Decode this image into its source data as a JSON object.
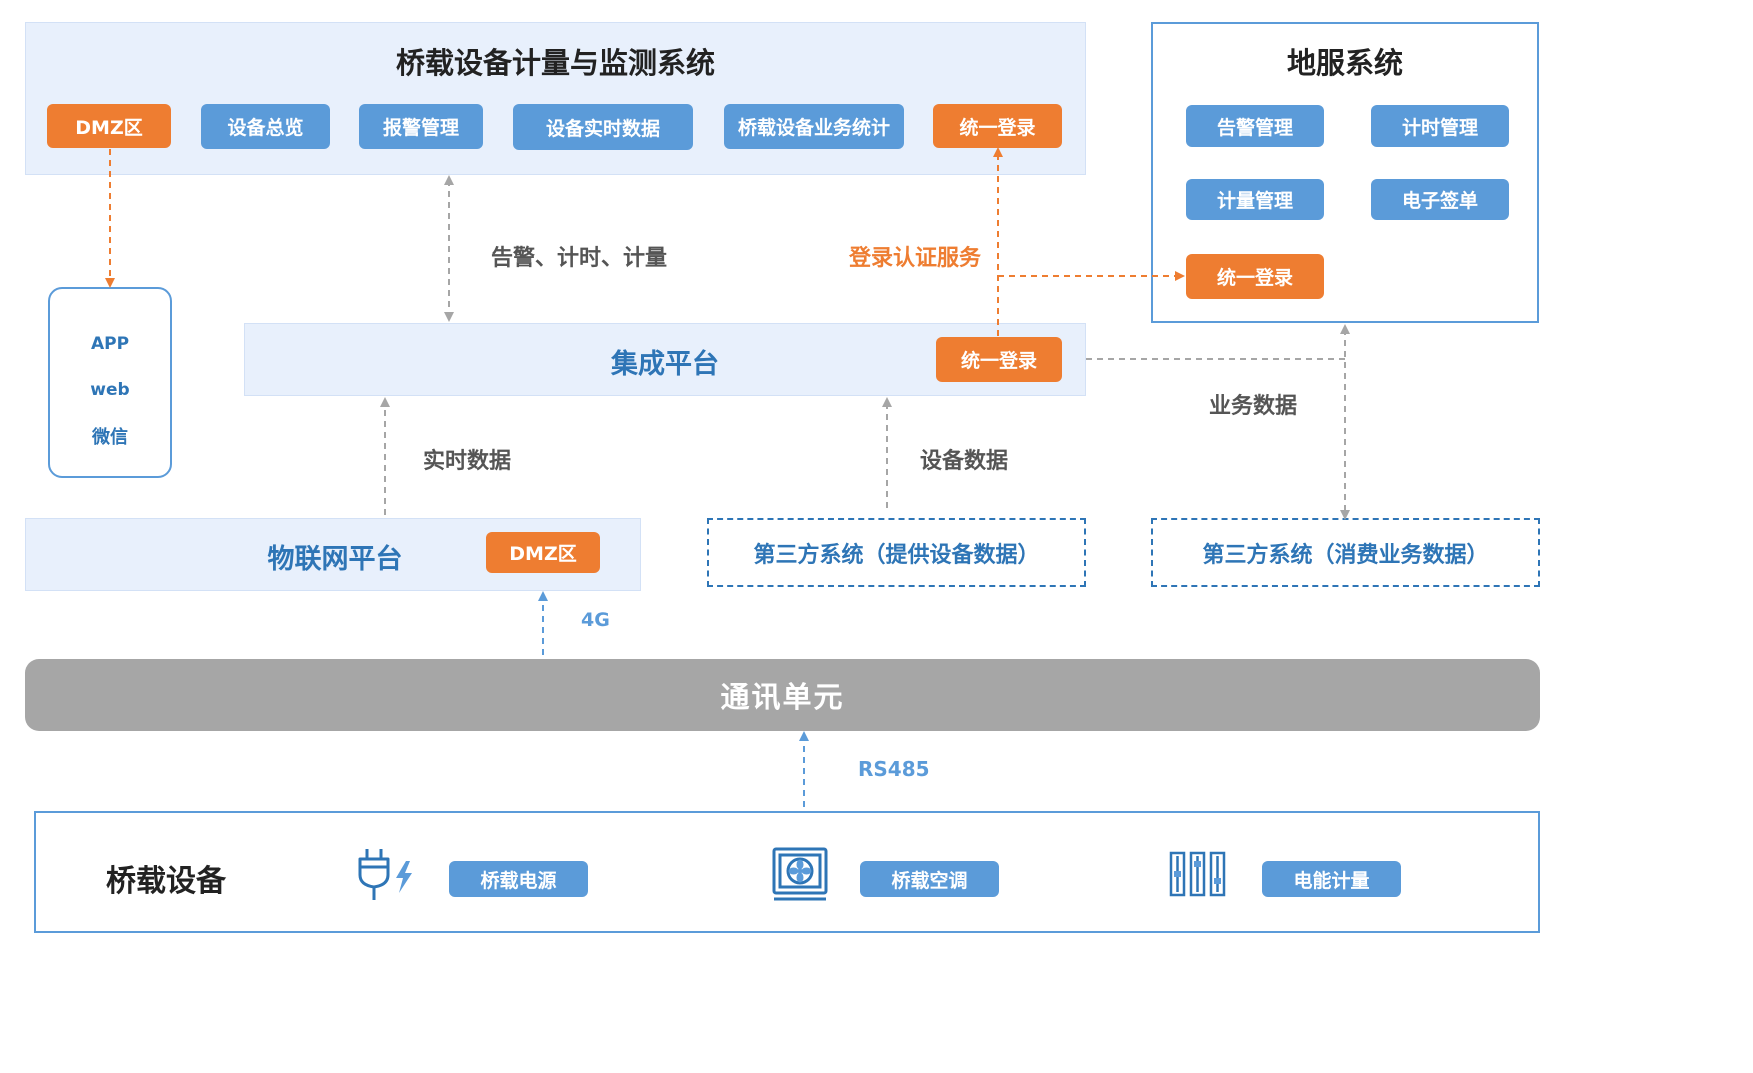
{
  "top_system": {
    "title": "桥载设备计量与监测系统",
    "modules": [
      "DMZ区",
      "设备总览",
      "报警管理",
      "设备实时数据",
      "桥载设备业务统计",
      "统一登录"
    ]
  },
  "ground_system": {
    "title": "地服系统",
    "modules": [
      "告警管理",
      "计时管理",
      "计量管理",
      "电子签单",
      "统一登录"
    ]
  },
  "clients": [
    "APP",
    "web",
    "微信"
  ],
  "integration_platform": {
    "title": "集成平台",
    "login": "统一登录"
  },
  "iot_platform": {
    "title": "物联网平台",
    "dmz": "DMZ区"
  },
  "third_party_device": "第三方系统（提供设备数据）",
  "third_party_business": "第三方系统（消费业务数据）",
  "comm_unit": "通讯单元",
  "edge_labels": {
    "alarm_timing_metering": "告警、计时、计量",
    "login_auth": "登录认证服务",
    "realtime_data": "实时数据",
    "device_data": "设备数据",
    "business_data": "业务数据",
    "net_4g": "4G",
    "rs485": "RS485"
  },
  "devices": {
    "title": "桥载设备",
    "items": [
      {
        "label": "桥载电源",
        "icon": "power-plug-icon"
      },
      {
        "label": "桥载空调",
        "icon": "air-conditioner-icon"
      },
      {
        "label": "电能计量",
        "icon": "energy-meter-icon"
      }
    ]
  },
  "colors": {
    "accent_blue": "#5b9bd9",
    "accent_orange": "#ee7d31",
    "panel_bg": "#e8f0fc",
    "comm_gray": "#a6a6a6",
    "title_blue": "#2e75b6"
  }
}
